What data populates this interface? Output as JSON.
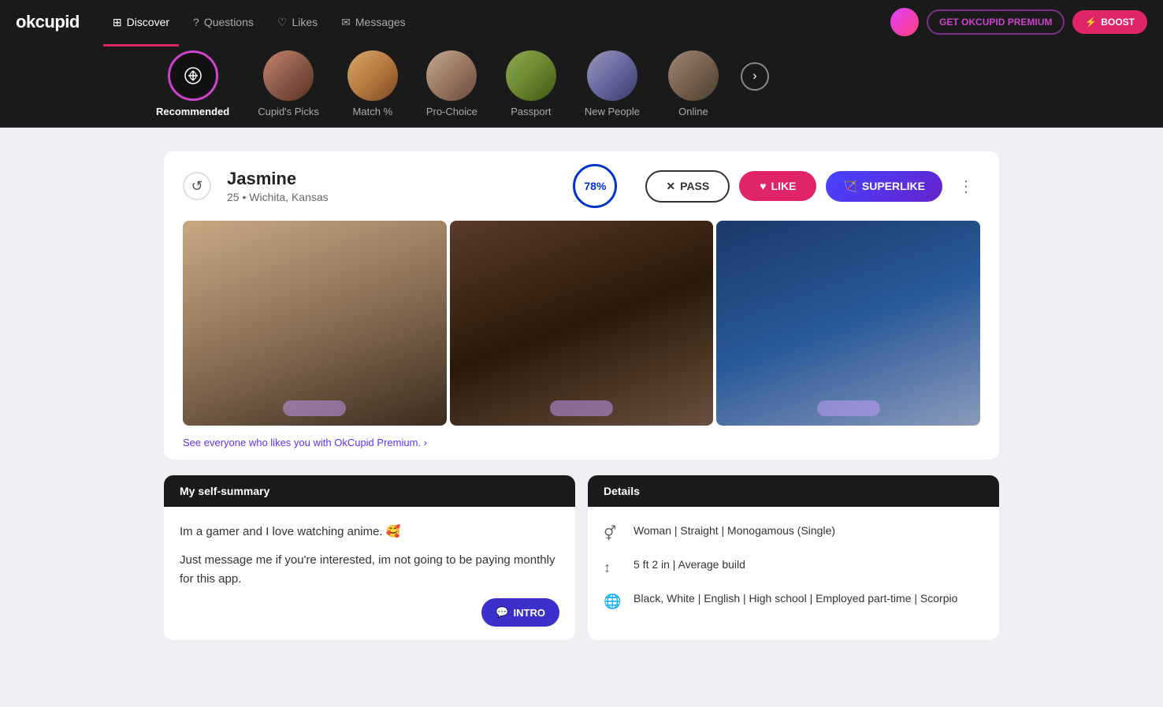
{
  "nav": {
    "logo": "okcupid",
    "items": [
      {
        "label": "Discover",
        "icon": "grid",
        "active": true
      },
      {
        "label": "Questions",
        "icon": "question"
      },
      {
        "label": "Likes",
        "icon": "heart"
      },
      {
        "label": "Messages",
        "icon": "message"
      }
    ],
    "premium_btn": "GET OKCUPID PREMIUM",
    "boost_btn": "BOOST",
    "boost_icon": "⚡"
  },
  "categories": [
    {
      "label": "Recommended",
      "active": true,
      "icon": "sun"
    },
    {
      "label": "Cupid's Picks",
      "active": false
    },
    {
      "label": "Match %",
      "active": false
    },
    {
      "label": "Pro-Choice",
      "active": false
    },
    {
      "label": "Passport",
      "active": false
    },
    {
      "label": "New People",
      "active": false
    },
    {
      "label": "Online",
      "active": false
    }
  ],
  "next_label": "›",
  "profile": {
    "undo_icon": "↺",
    "name": "Jasmine",
    "age": "25",
    "location": "Wichita, Kansas",
    "match_pct": "78%",
    "pass_label": "PASS",
    "like_label": "LIKE",
    "superlike_label": "SUPERLIKE",
    "more_icon": "⋮",
    "premium_prompt": "See everyone who likes you with OkCupid Premium. ›"
  },
  "self_summary": {
    "header": "My self-summary",
    "text1": "Im a gamer and I love watching anime. 🥰",
    "text2": "Just message me if you're interested, im not going to be paying monthly for this app.",
    "intro_label": "INTRO",
    "intro_icon": "💬"
  },
  "details": {
    "header": "Details",
    "rows": [
      {
        "icon": "person",
        "text": "Woman | Straight | Monogamous (Single)"
      },
      {
        "icon": "height",
        "text": "5 ft 2 in | Average build"
      },
      {
        "icon": "globe",
        "text": "Black, White | English | High school | Employed part-time | Scorpio"
      }
    ]
  }
}
